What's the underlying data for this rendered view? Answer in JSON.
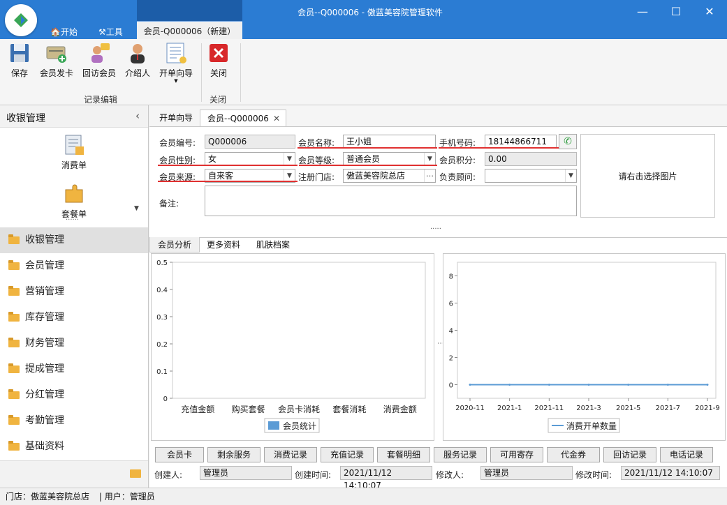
{
  "window": {
    "title": "会员--Q000006 - 傲蓝美容院管理软件",
    "minimize": "—",
    "maximize": "☐",
    "close": "✕"
  },
  "menu": {
    "start": "开始",
    "tools": "工具",
    "active_tab": "会员-Q000006（新建）"
  },
  "ribbon": {
    "buttons": [
      {
        "label": "保存",
        "icon": "save-icon"
      },
      {
        "label": "会员发卡",
        "icon": "card-add-icon"
      },
      {
        "label": "回访会员",
        "icon": "visit-icon"
      },
      {
        "label": "介绍人",
        "icon": "person-icon"
      },
      {
        "label": "开单向导",
        "icon": "wizard-icon"
      }
    ],
    "close_label": "关闭",
    "group_edit": "记录编辑",
    "group_close": "关闭"
  },
  "sidebar": {
    "header": "收银管理",
    "shortcuts": [
      {
        "label": "消费单",
        "icon": "bill-icon"
      },
      {
        "label": "套餐单",
        "icon": "package-icon"
      }
    ],
    "items": [
      "收银管理",
      "会员管理",
      "营销管理",
      "库存管理",
      "财务管理",
      "提成管理",
      "分红管理",
      "考勤管理",
      "基础资料"
    ]
  },
  "doc_tabs": [
    "开单向导",
    "会员--Q000006"
  ],
  "form": {
    "member_no_label": "会员编号:",
    "member_no": "Q000006",
    "name_label": "会员名称:",
    "name": "王小姐",
    "phone_label": "手机号码:",
    "phone": "18144866711",
    "gender_label": "会员性别:",
    "gender": "女",
    "level_label": "会员等级:",
    "level": "普通会员",
    "points_label": "会员积分:",
    "points": "0.00",
    "source_label": "会员来源:",
    "source": "自来客",
    "store_label": "注册门店:",
    "store": "傲蓝美容院总店",
    "advisor_label": "负责顾问:",
    "advisor": "",
    "remark_label": "备注:",
    "remark": "",
    "photo_hint": "请右击选择图片",
    "dots": "·····"
  },
  "sub_tabs": [
    "会员分析",
    "更多资料",
    "肌肤档案"
  ],
  "chart_data": [
    {
      "type": "bar",
      "categories": [
        "充值金额",
        "购买套餐",
        "会员卡消耗",
        "套餐消耗",
        "消费金额"
      ],
      "series": [
        {
          "name": "会员统计",
          "values": [
            0,
            0,
            0,
            0,
            0
          ]
        }
      ],
      "ylim": [
        0,
        0.5
      ],
      "yticks": [
        "0.5",
        "0.4",
        "0.3",
        "0.2",
        "0.1",
        "0"
      ],
      "color": "#5b9bd5"
    },
    {
      "type": "line",
      "x": [
        "2020-11",
        "2021-1",
        "2021-11",
        "2021-3",
        "2021-5",
        "2021-7",
        "2021-9"
      ],
      "series": [
        {
          "name": "消费开单数量",
          "values": [
            0,
            0,
            0,
            0,
            0,
            0,
            0
          ]
        }
      ],
      "ylim": [
        -1,
        9
      ],
      "yticks": [
        "8",
        "6",
        "4",
        "2",
        "0"
      ],
      "color": "#5b9bd5"
    }
  ],
  "bottom_buttons": [
    "会员卡",
    "剩余服务",
    "消费记录",
    "充值记录",
    "套餐明细",
    "服务记录",
    "可用寄存",
    "代金券",
    "回访记录",
    "电话记录"
  ],
  "audit": {
    "creator_label": "创建人:",
    "creator": "管理员",
    "created_label": "创建时间:",
    "created": "2021/11/12 14:10:07",
    "modifier_label": "修改人:",
    "modifier": "管理员",
    "modified_label": "修改时间:",
    "modified": "2021/11/12 14:10:07"
  },
  "status": {
    "store": "门店：傲蓝美容院总店",
    "user": "| 用户：管理员"
  }
}
